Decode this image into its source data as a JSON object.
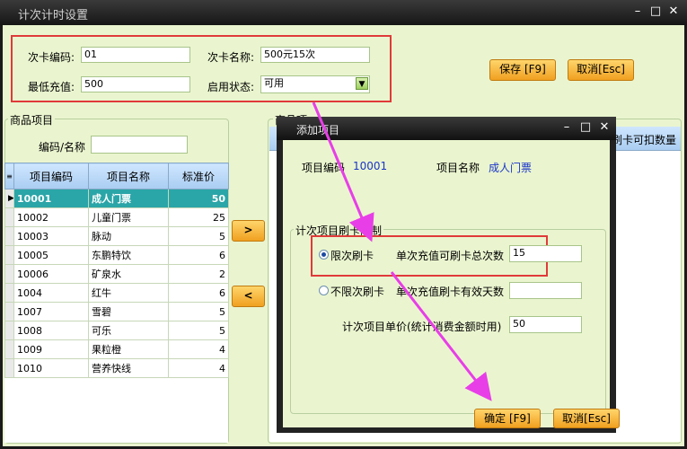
{
  "window": {
    "title": "计次计时设置",
    "minimize": "–",
    "maximize": "□",
    "close": "✕"
  },
  "card": {
    "code_label": "次卡编码:",
    "code_value": "01",
    "name_label": "次卡名称:",
    "name_value": "500元15次",
    "min_recharge_label": "最低充值:",
    "min_recharge_value": "500",
    "status_label": "启用状态:",
    "status_value": "可用"
  },
  "toolbar": {
    "save": "保存 [F9]",
    "cancel": "取消[Esc]"
  },
  "goods": {
    "group_title": "商品项目",
    "search_label": "编码/名称",
    "search_value": "",
    "columns": [
      "项目编码",
      "项目名称",
      "标准价"
    ],
    "rows": [
      {
        "code": "10001",
        "name": "成人门票",
        "price": "50",
        "selected": true
      },
      {
        "code": "10002",
        "name": "儿童门票",
        "price": "25"
      },
      {
        "code": "10003",
        "name": "脉动",
        "price": "5"
      },
      {
        "code": "10005",
        "name": "东鹏特饮",
        "price": "6"
      },
      {
        "code": "10006",
        "name": "矿泉水",
        "price": "2"
      },
      {
        "code": "1004",
        "name": "红牛",
        "price": "6"
      },
      {
        "code": "1007",
        "name": "雪碧",
        "price": "5"
      },
      {
        "code": "1008",
        "name": "可乐",
        "price": "5"
      },
      {
        "code": "1009",
        "name": "果粒橙",
        "price": "4"
      },
      {
        "code": "1010",
        "name": "营养快线",
        "price": "4"
      }
    ]
  },
  "transfer": {
    "add": ">",
    "remove": "<"
  },
  "right_panel": {
    "group_title": "商品项",
    "column_partial": "刷卡可扣数量"
  },
  "dialog": {
    "title": "添加项目",
    "item_code_label": "项目编码",
    "item_code_value": "10001",
    "item_name_label": "项目名称",
    "item_name_value": "成人门票",
    "limit_group_title": "计次项目刷卡限制",
    "limited_label": "限次刷卡",
    "limited_field_label": "单次充值可刷卡总次数",
    "limited_field_value": "15",
    "unlimited_label": "不限次刷卡",
    "unlimited_field_label": "单次充值刷卡有效天数",
    "unlimited_field_value": "",
    "unit_price_label": "计次项目单价(统计消费金额时用)",
    "unit_price_value": "50",
    "confirm": "确定 [F9]",
    "cancel": "取消[Esc]",
    "minimize": "–",
    "maximize": "□",
    "close": "✕"
  },
  "colors": {
    "accent_red": "#e03a3a",
    "arrow": "#e83ee8",
    "selection": "#2aa5a8",
    "panel": "#eaf5cf"
  }
}
